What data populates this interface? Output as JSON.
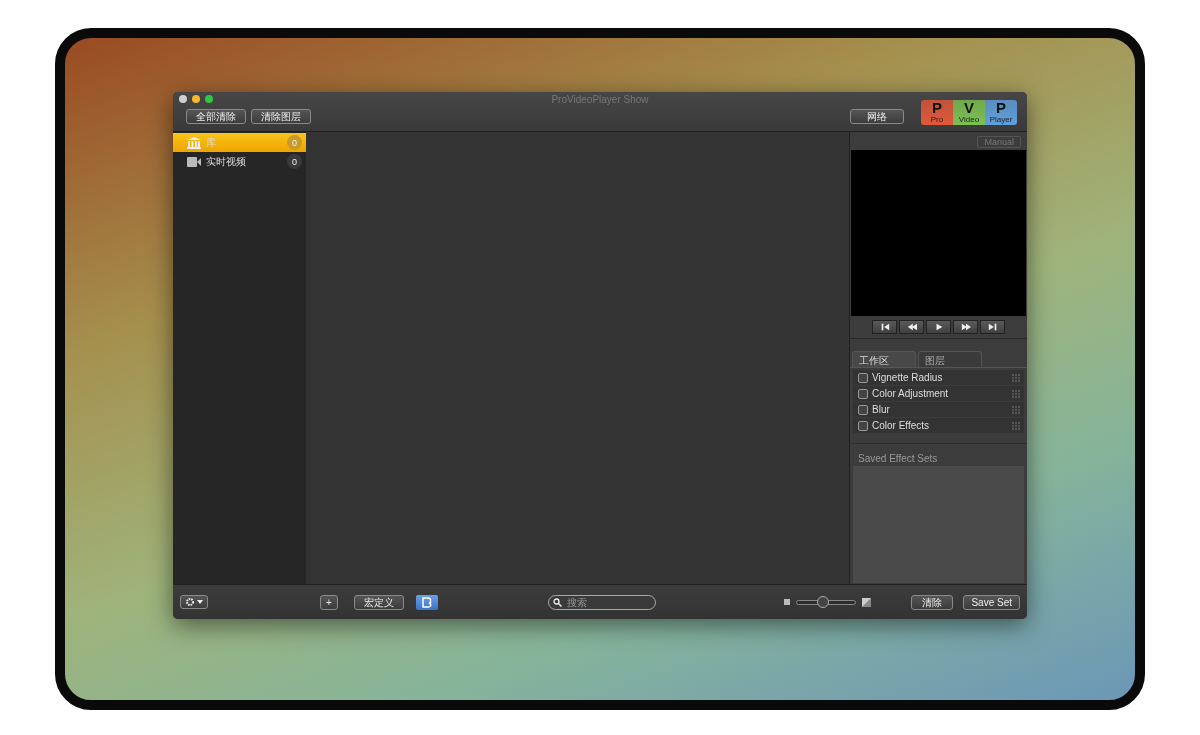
{
  "window": {
    "title": "ProVideoPlayer Show"
  },
  "toolbar": {
    "buttons": [
      "全部清除",
      "清除图层"
    ],
    "network_button": "网络",
    "logo": [
      {
        "letter": "P",
        "caption": "Pro",
        "color": "#e0583a"
      },
      {
        "letter": "V",
        "caption": "Video",
        "color": "#7cc152"
      },
      {
        "letter": "P",
        "caption": "Player",
        "color": "#5fa0dc"
      }
    ]
  },
  "sidebar": {
    "items": [
      {
        "kind": "library",
        "label": "库",
        "count": "0",
        "selected": true
      },
      {
        "kind": "camera",
        "label": "实时视频",
        "count": "0",
        "selected": false
      }
    ]
  },
  "preview": {
    "mode_button": "Manual"
  },
  "transport": [
    {
      "kind": "first"
    },
    {
      "kind": "rewind"
    },
    {
      "kind": "play"
    },
    {
      "kind": "forward"
    },
    {
      "kind": "last"
    }
  ],
  "tabs": [
    {
      "label": "工作区",
      "selected": true
    },
    {
      "label": "图层",
      "selected": false
    }
  ],
  "effects": [
    {
      "name": "Vignette Radius",
      "checked": false
    },
    {
      "name": "Color Adjustment",
      "checked": false
    },
    {
      "name": "Blur",
      "checked": false
    },
    {
      "name": "Color Effects",
      "checked": false
    }
  ],
  "saved_sets": {
    "title": "Saved Effect Sets"
  },
  "bottom_bar": {
    "add_button": "+",
    "macro_button": "宏定义",
    "search": {
      "placeholder": "搜索"
    },
    "size_slider": {
      "level": 0.45
    },
    "clear_button": "清除",
    "save_button": "Save Set"
  }
}
